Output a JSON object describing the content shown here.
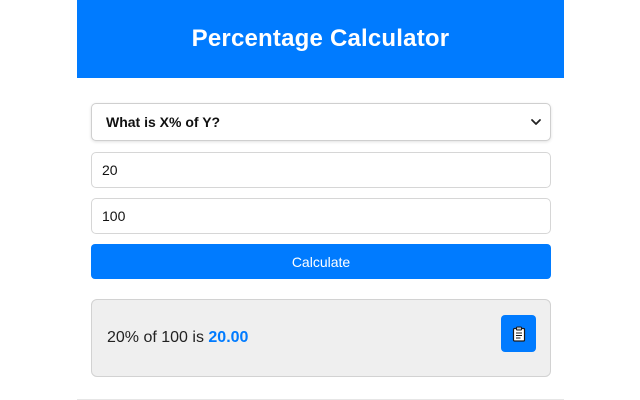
{
  "header": {
    "title": "Percentage Calculator"
  },
  "form": {
    "mode_select": {
      "selected": "What is X% of Y?"
    },
    "input_x": {
      "value": "20"
    },
    "input_y": {
      "value": "100"
    },
    "calculate_label": "Calculate"
  },
  "result": {
    "prefix": "20% of 100 is ",
    "value": "20.00",
    "copy_icon": "clipboard-icon"
  },
  "colors": {
    "accent": "#007bff",
    "result_bg": "#efefef"
  }
}
